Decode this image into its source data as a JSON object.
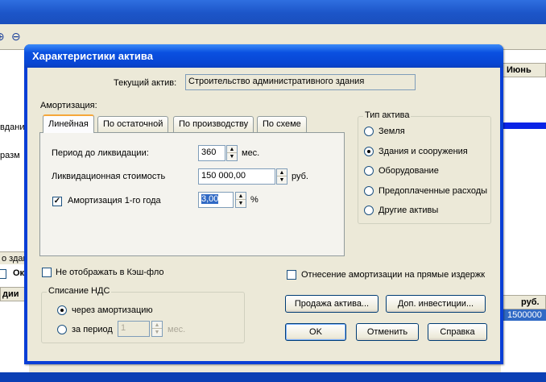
{
  "background": {
    "toolbar_icons": [
      "zoom-in-icon",
      "zoom-out-icon"
    ],
    "left_texts": [
      "вдани",
      "разм"
    ],
    "left_strip": "о здан",
    "left_box_label": "Ок",
    "left_head": "дии",
    "right_head": "Июнь",
    "right_head2": "руб.",
    "right_selected_value": "1500000"
  },
  "dialog": {
    "title": "Характеристики актива",
    "current_asset_label": "Текущий актив:",
    "current_asset_value": "Строительство административного здания",
    "amortization_label": "Амортизация:",
    "tabs": [
      {
        "label": "Линейная",
        "active": true
      },
      {
        "label": "По остаточной",
        "active": false
      },
      {
        "label": "По производству",
        "active": false
      },
      {
        "label": "По схеме",
        "active": false
      }
    ],
    "linear": {
      "period_label": "Период до ликвидации:",
      "period_value": "360",
      "period_unit": "мес.",
      "liquidation_label": "Ликвидационная стоимость",
      "liquidation_value": "150 000,00",
      "liquidation_unit": "руб.",
      "first_year_label": "Амортизация 1-го года",
      "first_year_checked": true,
      "first_year_value": "3,00",
      "first_year_unit": "%"
    },
    "asset_type": {
      "caption": "Тип актива",
      "options": [
        {
          "label": "Земля",
          "selected": false
        },
        {
          "label": "Здания и сооружения",
          "selected": true
        },
        {
          "label": "Оборудование",
          "selected": false
        },
        {
          "label": "Предоплаченные расходы",
          "selected": false
        },
        {
          "label": "Другие активы",
          "selected": false
        }
      ]
    },
    "hide_cashflow_label": "Не отображать в Кэш-фло",
    "direct_costs_label": "Отнесение амортизации на прямые издержк",
    "vat": {
      "caption": "Списание НДС",
      "via_amortization": "через амортизацию",
      "for_period": "за период",
      "period_value": "1",
      "period_unit": "мес."
    },
    "buttons": {
      "sell": "Продажа актива...",
      "extra_invest": "Доп. инвестиции...",
      "ok": "OK",
      "cancel": "Отменить",
      "help": "Справка"
    }
  }
}
